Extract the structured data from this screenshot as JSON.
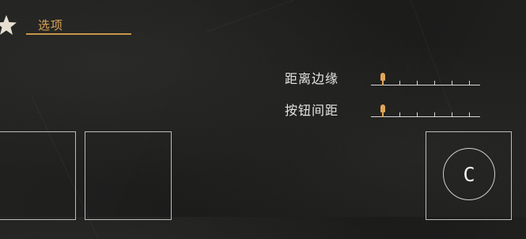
{
  "header": {
    "title": "选项",
    "icon": "star-icon"
  },
  "settings": [
    {
      "label": "距离边缘",
      "slider": {
        "value": 0,
        "steps": 5
      }
    },
    {
      "label": "按钮间距",
      "slider": {
        "value": 0,
        "steps": 5
      }
    }
  ],
  "action_button": {
    "label": "C"
  },
  "colors": {
    "accent": "#d9a457",
    "text": "#e4e4e4",
    "background": "#1d1d1c",
    "border": "#bcbcbc"
  }
}
